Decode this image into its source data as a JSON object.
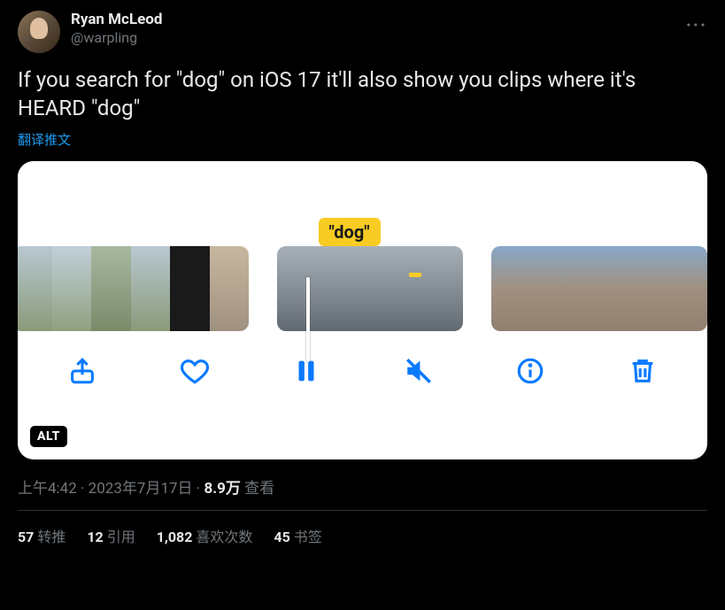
{
  "user": {
    "display_name": "Ryan McLeod",
    "handle": "@warpling"
  },
  "tweet": {
    "text": "If you search for \"dog\" on iOS 17 it'll also show you clips where it's HEARD \"dog\"",
    "translate_label": "翻译推文"
  },
  "media": {
    "search_pill": "\"dog\"",
    "alt_badge": "ALT",
    "toolbar": {
      "share": "share",
      "like": "like",
      "pause": "pause",
      "mute": "mute",
      "info": "info",
      "trash": "trash"
    }
  },
  "meta": {
    "time": "上午4:42",
    "date": "2023年7月17日",
    "views_count": "8.9万",
    "views_label": "查看"
  },
  "stats": {
    "retweets": {
      "count": "57",
      "label": "转推"
    },
    "quotes": {
      "count": "12",
      "label": "引用"
    },
    "likes": {
      "count": "1,082",
      "label": "喜欢次数"
    },
    "bookmarks": {
      "count": "45",
      "label": "书签"
    }
  }
}
